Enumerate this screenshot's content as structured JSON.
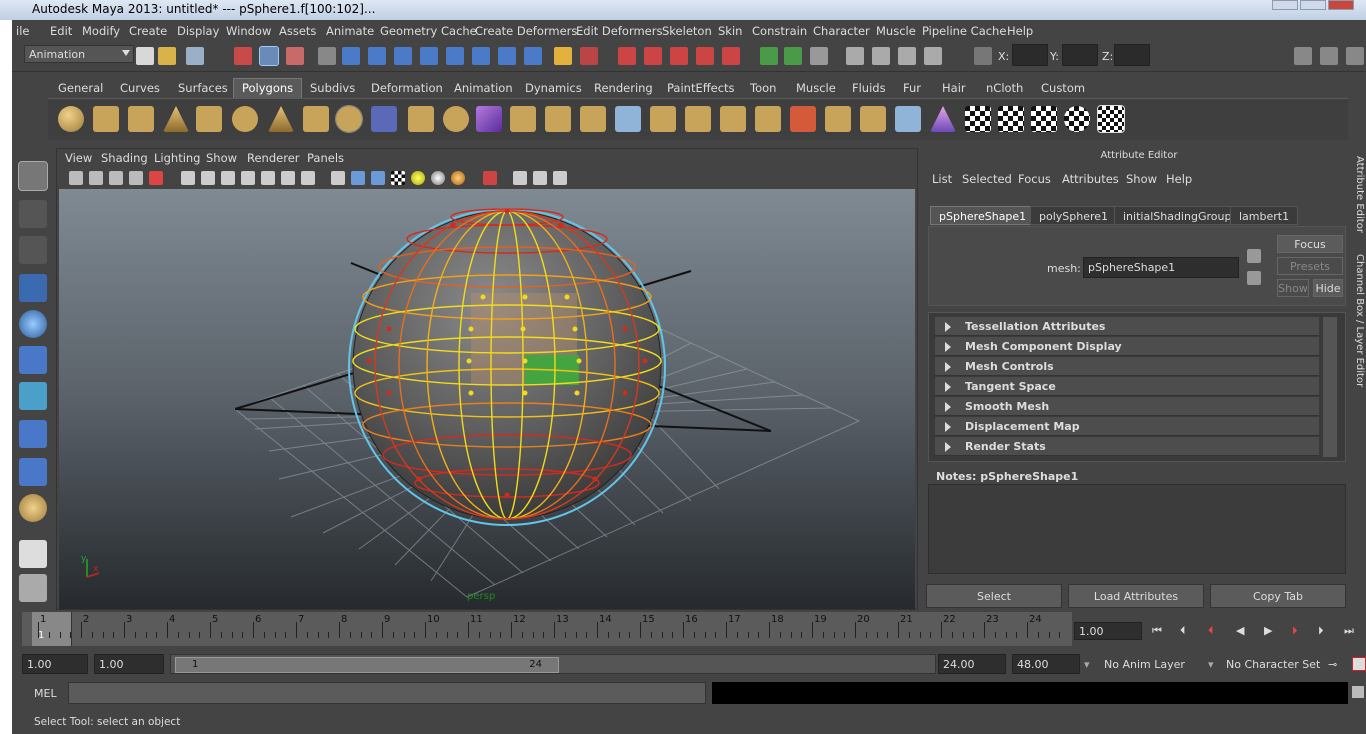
{
  "window": {
    "title": "Autodesk Maya 2013: untitled*   ---   pSphere1.f[100:102]..."
  },
  "menus": [
    "ile",
    "Edit",
    "Modify",
    "Create",
    "Display",
    "Window",
    "Assets",
    "Animate",
    "Geometry Cache",
    "Create Deformers",
    "Edit Deformers",
    "Skeleton",
    "Skin",
    "Constrain",
    "Character",
    "Muscle",
    "Pipeline Cache",
    "Help"
  ],
  "statusline": {
    "mode": "Animation",
    "x_label": "X:",
    "y_label": "Y:",
    "z_label": "Z:"
  },
  "shelf_tabs": [
    "General",
    "Curves",
    "Surfaces",
    "Polygons",
    "Subdivs",
    "Deformation",
    "Animation",
    "Dynamics",
    "Rendering",
    "PaintEffects",
    "Toon",
    "Muscle",
    "Fluids",
    "Fur",
    "Hair",
    "nCloth",
    "Custom"
  ],
  "shelf_active": "Polygons",
  "panel_menus": [
    "View",
    "Shading",
    "Lighting",
    "Show",
    "Renderer",
    "Panels"
  ],
  "viewport": {
    "camera_label": "persp",
    "axis_y": "y",
    "axis_x": "x"
  },
  "attribute_editor": {
    "title": "Attribute Editor",
    "menus": [
      "List",
      "Selected",
      "Focus",
      "Attributes",
      "Show",
      "Help"
    ],
    "tabs": [
      "pSphereShape1",
      "polySphere1",
      "initialShadingGroup",
      "lambert1"
    ],
    "mesh_label": "mesh:",
    "mesh_value": "pSphereShape1",
    "focus_label": "Focus",
    "presets_label": "Presets",
    "show_label": "Show",
    "hide_label": "Hide",
    "sections": [
      "Tessellation Attributes",
      "Mesh Component Display",
      "Mesh Controls",
      "Tangent Space",
      "Smooth Mesh",
      "Displacement Map",
      "Render Stats"
    ],
    "notes_label": "Notes:  pSphereShape1",
    "buttons": [
      "Select",
      "Load Attributes",
      "Copy Tab"
    ],
    "side_tabs": [
      "Attribute Editor",
      "Channel Box / Layer Editor"
    ]
  },
  "timeline": {
    "frames": [
      "1",
      "2",
      "3",
      "4",
      "5",
      "6",
      "7",
      "8",
      "9",
      "10",
      "11",
      "12",
      "13",
      "14",
      "15",
      "16",
      "17",
      "18",
      "19",
      "20",
      "21",
      "22",
      "23",
      "24"
    ],
    "current_marker": "1",
    "current_frame": "1.00"
  },
  "range": {
    "start": "1.00",
    "start2": "1.00",
    "range_start": "1",
    "range_end": "24",
    "end": "24.00",
    "end2": "48.00",
    "anim_layer": "No Anim Layer",
    "character_set": "No Character Set"
  },
  "mel": {
    "label": "MEL"
  },
  "status": {
    "help": "Select Tool: select an object"
  },
  "colors": {
    "bg": "#444444",
    "wire_red": "#d42a1e",
    "wire_yellow": "#f2dc1a",
    "face_selected": "#3ca83c",
    "highlight": "#62c6e8"
  }
}
